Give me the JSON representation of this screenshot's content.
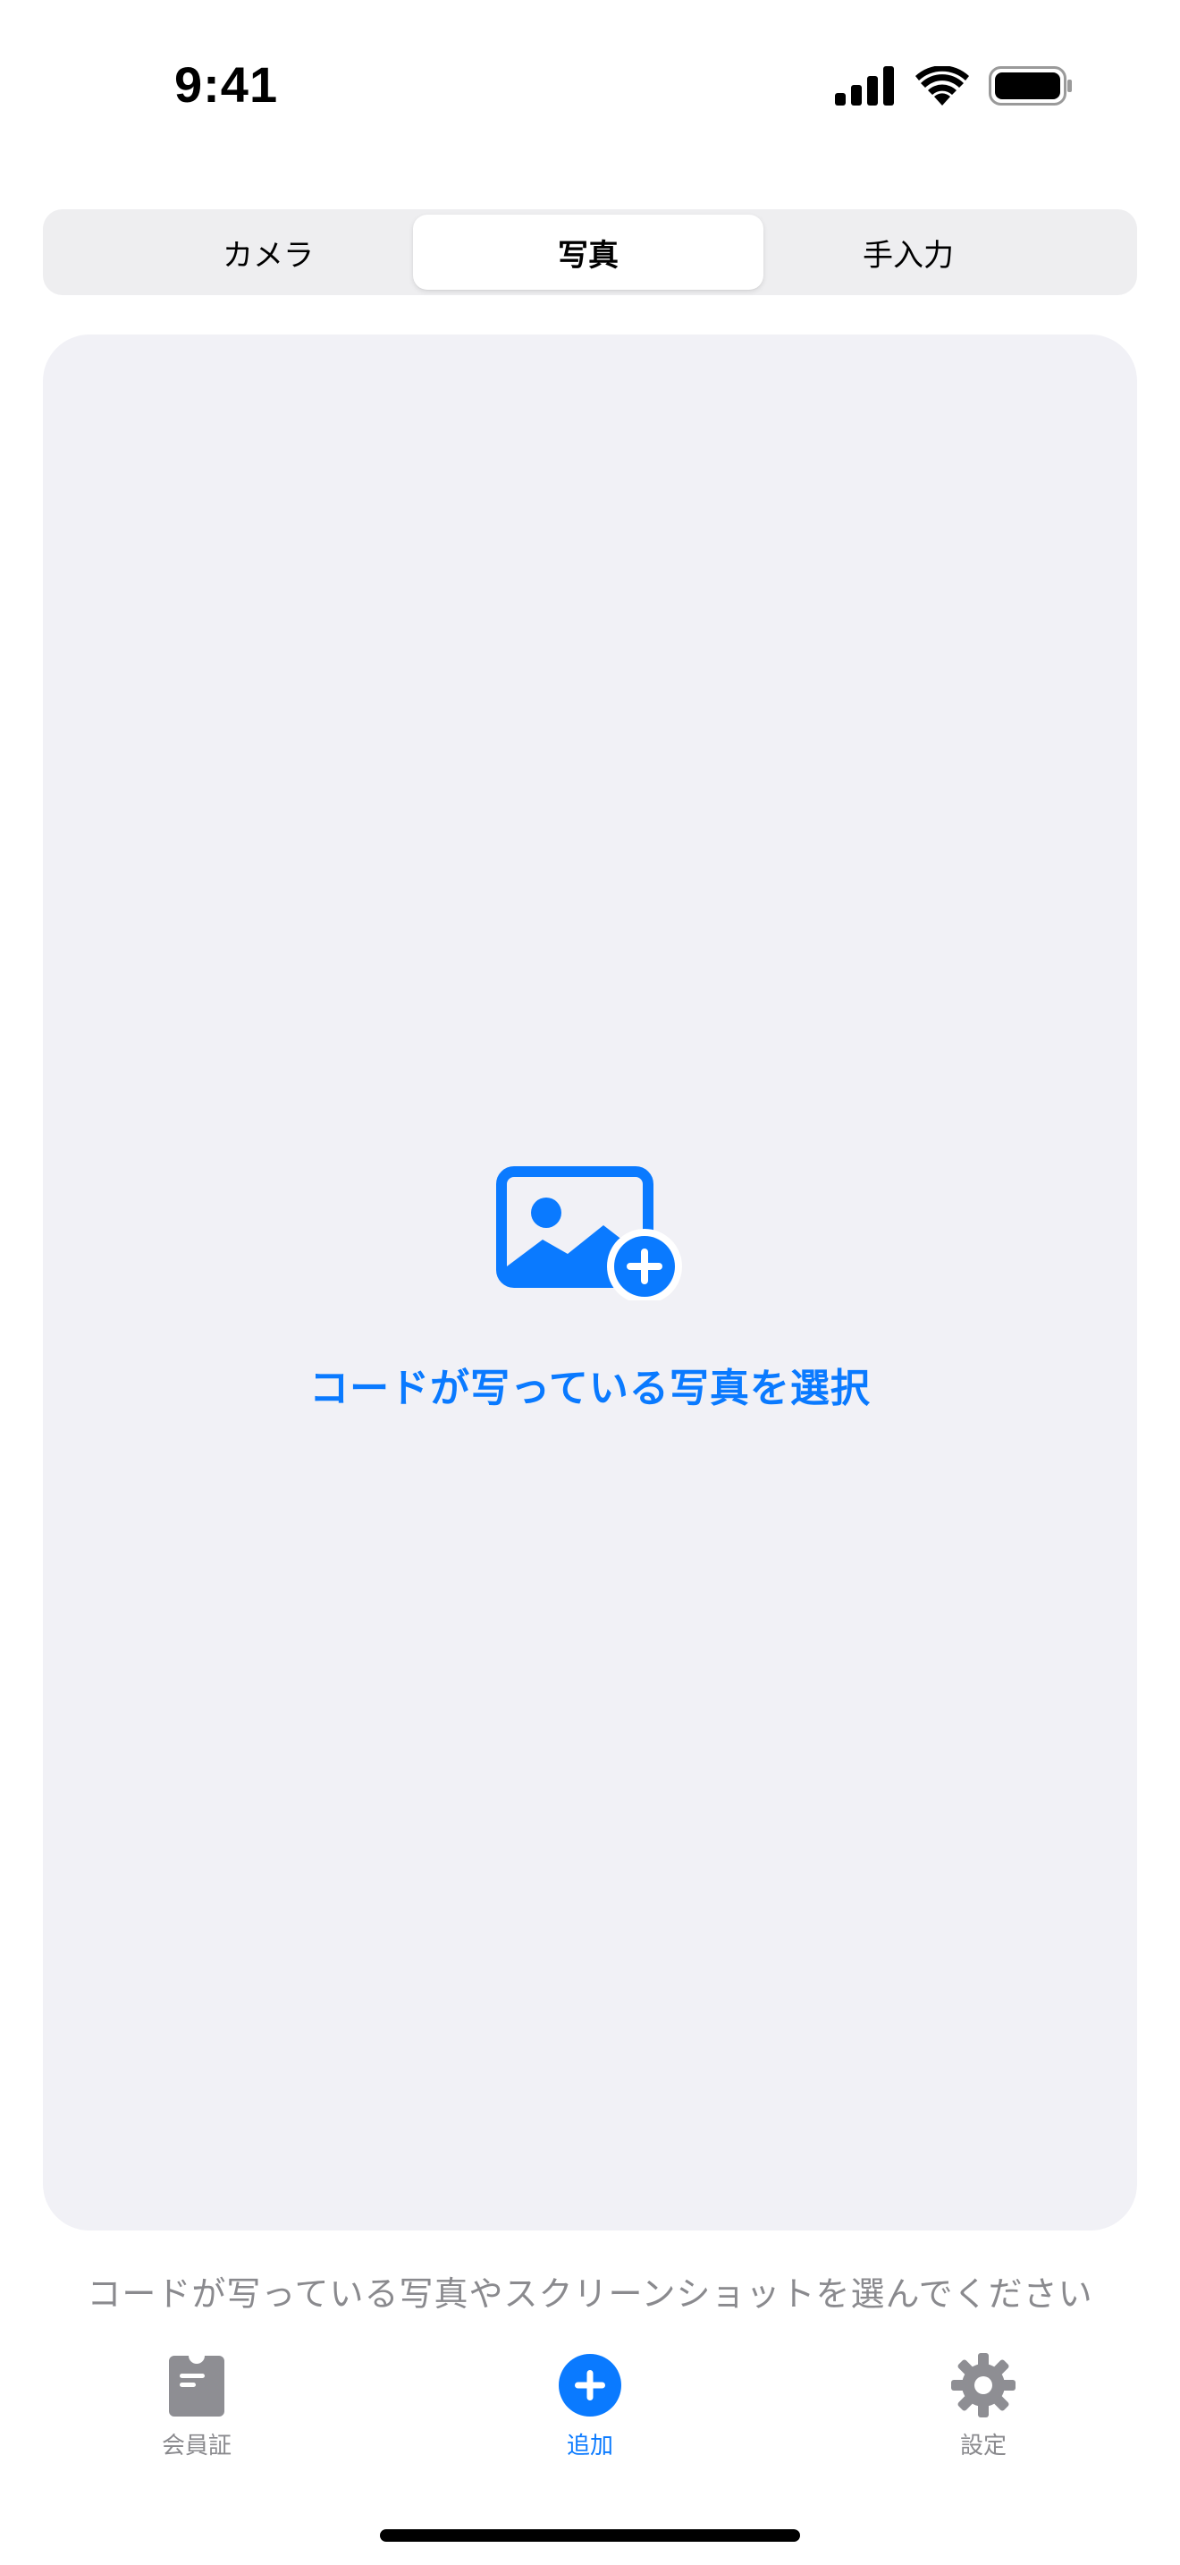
{
  "status_bar": {
    "time": "9:41",
    "icons": [
      "cellular-signal-icon",
      "wifi-icon",
      "battery-icon"
    ]
  },
  "segmented_control": {
    "segments": [
      {
        "label": "カメラ",
        "selected": false
      },
      {
        "label": "写真",
        "selected": true
      },
      {
        "label": "手入力",
        "selected": false
      }
    ]
  },
  "picker": {
    "icon": "photo-badge-plus-icon",
    "label": "コードが写っている写真を選択"
  },
  "hint": "コードが写っている写真やスクリーンショットを選んでください",
  "tab_bar": {
    "items": [
      {
        "label": "会員証",
        "icon": "membership-card-icon",
        "selected": false
      },
      {
        "label": "追加",
        "icon": "plus-circle-icon",
        "selected": true
      },
      {
        "label": "設定",
        "icon": "gear-icon",
        "selected": false
      }
    ]
  },
  "colors": {
    "accent": "#0a7aff",
    "card_background": "#f1f1f6",
    "segmented_background": "#eeeef0",
    "secondary_text": "#8a8a8e",
    "inactive_tab_icon": "#8e8e93"
  }
}
